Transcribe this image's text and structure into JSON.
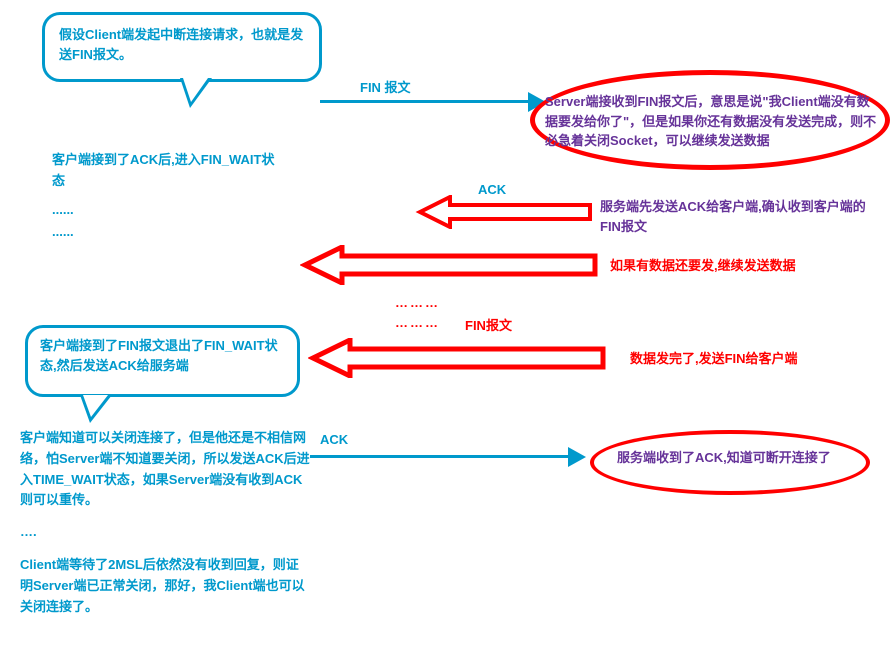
{
  "bubble1_text": "假设Client端发起中断连接请求，也就是发送FIN报文。",
  "client_ack_text": "客户端接到了ACK后,进入FIN_WAIT状态",
  "dots1": "......",
  "dots2": "......",
  "bubble2_text": "客户端接到了FIN报文退出了FIN_WAIT状态,然后发送ACK给服务端",
  "client_bottom1": "客户端知道可以关闭连接了，但是他还是不相信网络，怕Server端不知道要关闭，所以发送ACK后进入TIME_WAIT状态，如果Server端没有收到ACK则可以重传。",
  "client_bottom_dots": "….",
  "client_bottom2": "Client端等待了2MSL后依然没有收到回复，则证明Server端已正常关闭，那好，我Client端也可以关闭连接了。",
  "label_fin1": "FIN 报文",
  "label_ack1": "ACK",
  "label_fin2": "FIN报文",
  "label_ack2": "ACK",
  "dotted1": "………",
  "dotted2": "………",
  "server_recv_fin": "Server端接收到FIN报文后，意思是说\"我Client端没有数据要发给你了\"，但是如果你还有数据没有发送完成，则不必急着关闭Socket，可以继续发送数据",
  "server_send_ack": "服务端先发送ACK给客户端,确认收到客户端的FIN报文",
  "server_continue": "如果有数据还要发,继续发送数据",
  "server_send_fin": "数据发完了,发送FIN给客户端",
  "server_recv_ack": "服务端收到了ACK,知道可断开连接了"
}
